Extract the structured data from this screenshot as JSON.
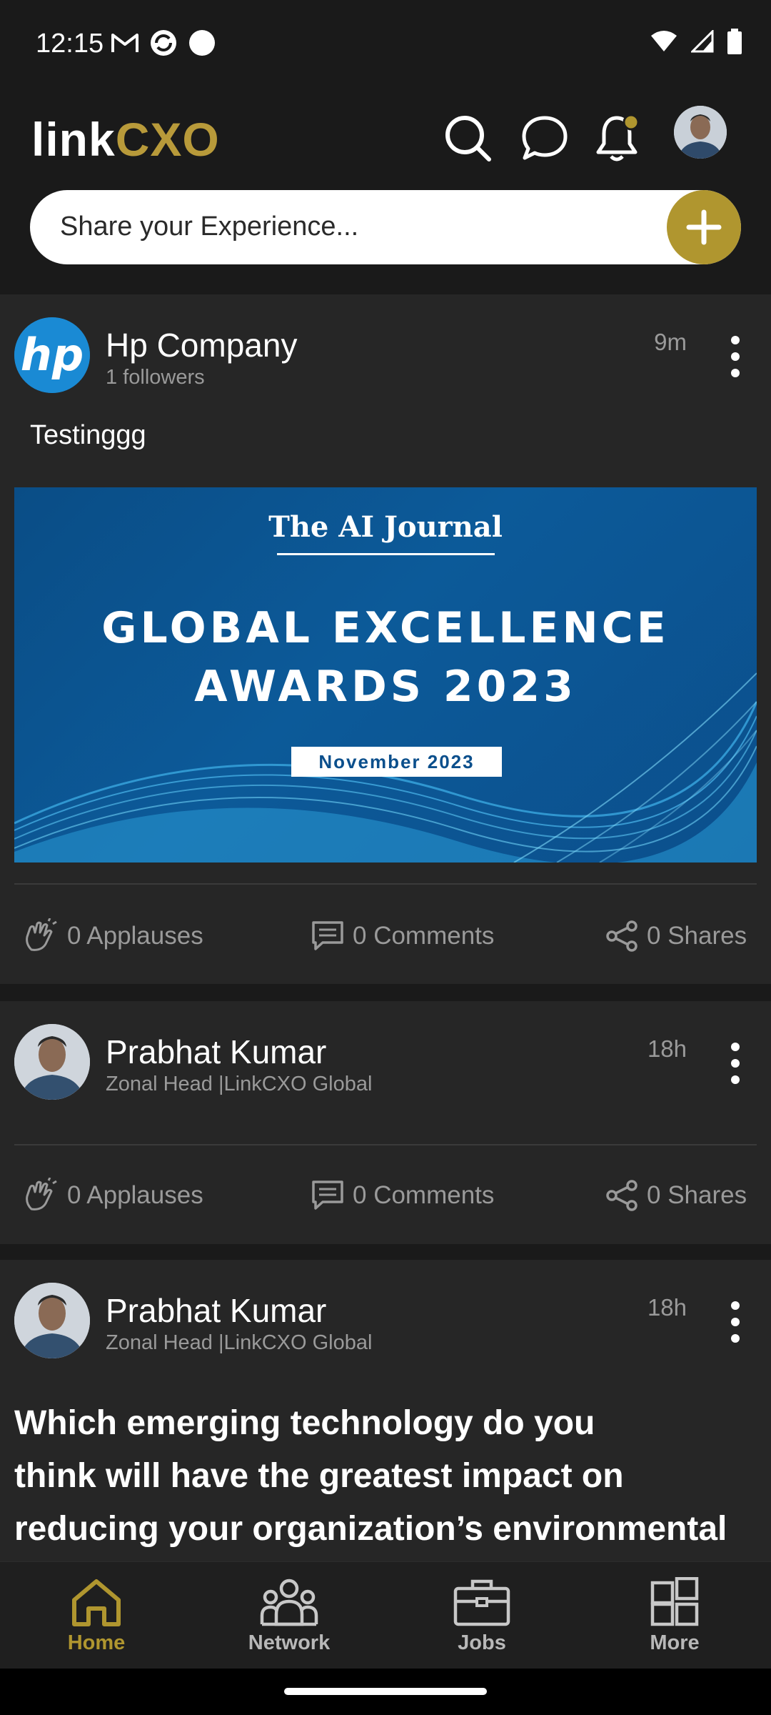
{
  "status_bar": {
    "time": "12:15"
  },
  "header": {
    "logo_part1": "link",
    "logo_part2": "CXO",
    "share_placeholder": "Share your Experience..."
  },
  "posts": [
    {
      "author": "Hp Company",
      "subtitle": "1 followers",
      "time": "9m",
      "text": "Testinggg",
      "banner": {
        "journal": "The AI Journal",
        "title_line1": "GLOBAL EXCELLENCE",
        "title_line2": "AWARDS 2023",
        "date": "November 2023"
      },
      "applauses": "0 Applauses",
      "comments": "0 Comments",
      "shares": "0 Shares"
    },
    {
      "author": "Prabhat Kumar",
      "subtitle": "Zonal Head |LinkCXO Global",
      "time": "18h",
      "applauses": "0 Applauses",
      "comments": "0 Comments",
      "shares": "0 Shares"
    },
    {
      "author": "Prabhat Kumar",
      "subtitle": "Zonal Head |LinkCXO Global",
      "time": "18h",
      "question_line1": "Which emerging technology do you",
      "question_line2": "think will have the greatest impact on",
      "question_line3": "reducing your organization’s environmental"
    }
  ],
  "bottom_nav": [
    {
      "label": "Home",
      "icon": "home-icon",
      "active": true
    },
    {
      "label": "Network",
      "icon": "network-icon",
      "active": false
    },
    {
      "label": "Jobs",
      "icon": "briefcase-icon",
      "active": false
    },
    {
      "label": "More",
      "icon": "grid-icon",
      "active": false
    }
  ],
  "colors": {
    "accent": "#b0962f",
    "background": "#1a1a1a",
    "card": "#262626",
    "muted_text": "#9a9a9a"
  }
}
